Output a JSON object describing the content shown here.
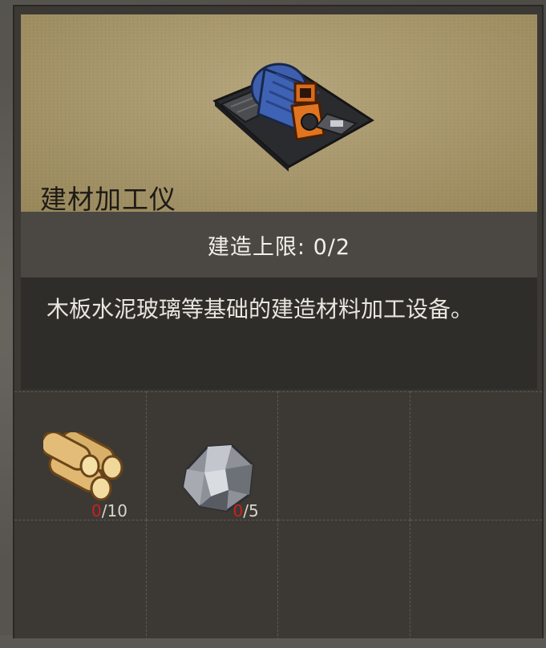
{
  "item": {
    "name": "建材加工仪",
    "icon": "building-material-processor-icon"
  },
  "build_limit": {
    "label": "建造上限: 0/2"
  },
  "description": "木板水泥玻璃等基础的建造材料加工设备。",
  "materials": [
    {
      "icon": "wood-logs-icon",
      "have": "0",
      "need": "/10"
    },
    {
      "icon": "stone-ore-icon",
      "have": "0",
      "need": "/5"
    }
  ],
  "colors": {
    "header_bg": "#a6956a",
    "panel_bg": "#3c3935",
    "missing_count": "#c8211e"
  }
}
